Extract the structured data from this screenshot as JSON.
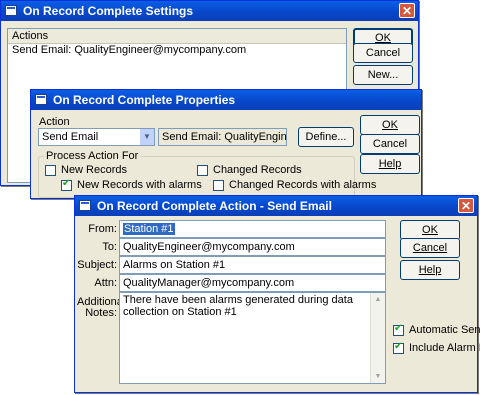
{
  "settings": {
    "title": "On Record Complete Settings",
    "list_header": "Actions",
    "list_items": [
      "Send Email: QualityEngineer@mycompany.com"
    ],
    "ok": "OK",
    "cancel": "Cancel",
    "new": "New..."
  },
  "properties": {
    "title": "On Record Complete Properties",
    "action_label": "Action",
    "action_value": "Send Email",
    "action_desc": "Send Email: QualityEngineer@myc",
    "define": "Define...",
    "group_label": "Process Action For",
    "checks": [
      {
        "label": "New Records",
        "checked": false
      },
      {
        "label": "Changed Records",
        "checked": false
      },
      {
        "label": "New Records with alarms",
        "checked": true
      },
      {
        "label": "Changed Records with alarms",
        "checked": false
      }
    ],
    "ok": "OK",
    "cancel": "Cancel",
    "help": "Help"
  },
  "email": {
    "title": "On Record Complete Action - Send Email",
    "from_label": "From:",
    "from_value": "Station #1",
    "to_label": "To:",
    "to_value": "QualityEngineer@mycompany.com",
    "subject_label": "Subject:",
    "subject_value": "Alarms on Station #1",
    "attn_label": "Attn:",
    "attn_value": "QualityManager@mycompany.com",
    "notes_label_1": "Additional",
    "notes_label_2": "Notes:",
    "notes_value": "There have been alarms generated during data collection on Station #1",
    "ok": "OK",
    "cancel": "Cancel",
    "help": "Help",
    "auto_send_label": "Automatic Send",
    "auto_send": true,
    "alarm_list_label": "Include Alarm List",
    "alarm_list": true
  }
}
